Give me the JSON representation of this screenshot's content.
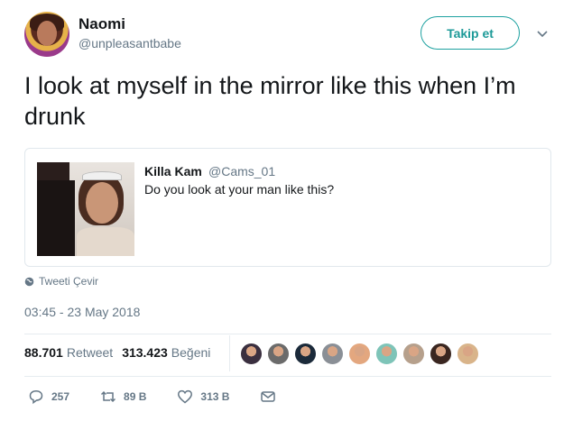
{
  "author": {
    "name": "Naomi",
    "handle": "@unpleasantbabe",
    "follow_label": "Takip et"
  },
  "tweet": {
    "text": "I look at myself in the mirror like this when I’m drunk"
  },
  "quoted": {
    "name": "Killa Kam",
    "handle": "@Cams_01",
    "text": "Do you look at your man like this?"
  },
  "translate_label": "Tweeti Çevir",
  "timestamp": "03:45 - 23 May 2018",
  "stats": {
    "retweets": "88.701",
    "retweets_label": "Retweet",
    "likes": "313.423",
    "likes_label": "Beğeni"
  },
  "likers_colors": [
    "#3a2f3f",
    "#6b6b6b",
    "#1b2a3a",
    "#8a8f96",
    "#e3a77f",
    "#7ec4b8",
    "#b6a08c",
    "#3a2620",
    "#d9b48a"
  ],
  "actions": {
    "replies": "257",
    "retweets": "89 B",
    "likes": "313 B"
  },
  "colors": {
    "accent": "#1da1a0",
    "muted": "#657786"
  }
}
